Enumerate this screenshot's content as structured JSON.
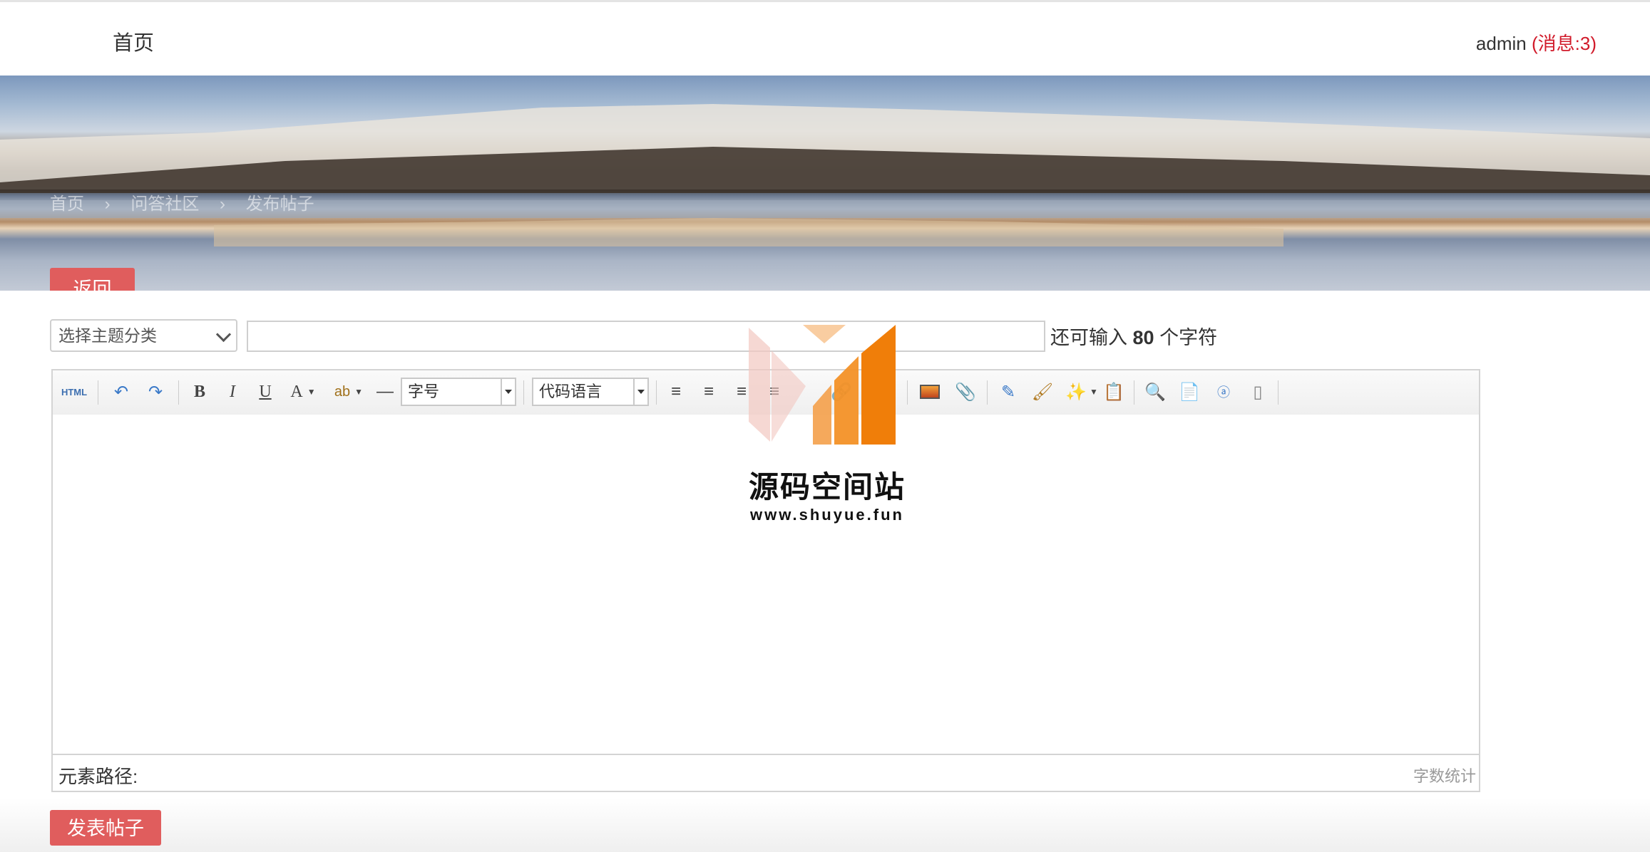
{
  "nav": {
    "home_label": "首页",
    "user": "admin",
    "messages": "(消息:3)"
  },
  "breadcrumb": {
    "items": [
      "首页",
      "›",
      "问答社区",
      "›",
      "发布帖子"
    ]
  },
  "actions": {
    "back_label": "返回",
    "submit_label": "发表帖子"
  },
  "form": {
    "category_placeholder": "选择主题分类",
    "title_value": "",
    "counter_prefix": "还可输入 ",
    "counter_number": "80",
    "counter_suffix": " 个字符"
  },
  "editor": {
    "toolbar": {
      "html_label": "HTML",
      "bold_label": "B",
      "italic_label": "I",
      "underline_label": "U",
      "fontcolor_label": "A",
      "hr_label": "—",
      "fontsize_select": "字号",
      "codelang_select": "代码语言"
    },
    "path_label": "元素路径:",
    "wordcount_label": "字数统计"
  },
  "watermark": {
    "title": "源码空间站",
    "url": "www.shuyue.fun"
  },
  "colors": {
    "accent": "#e05d5d",
    "message": "#d11a2a"
  }
}
